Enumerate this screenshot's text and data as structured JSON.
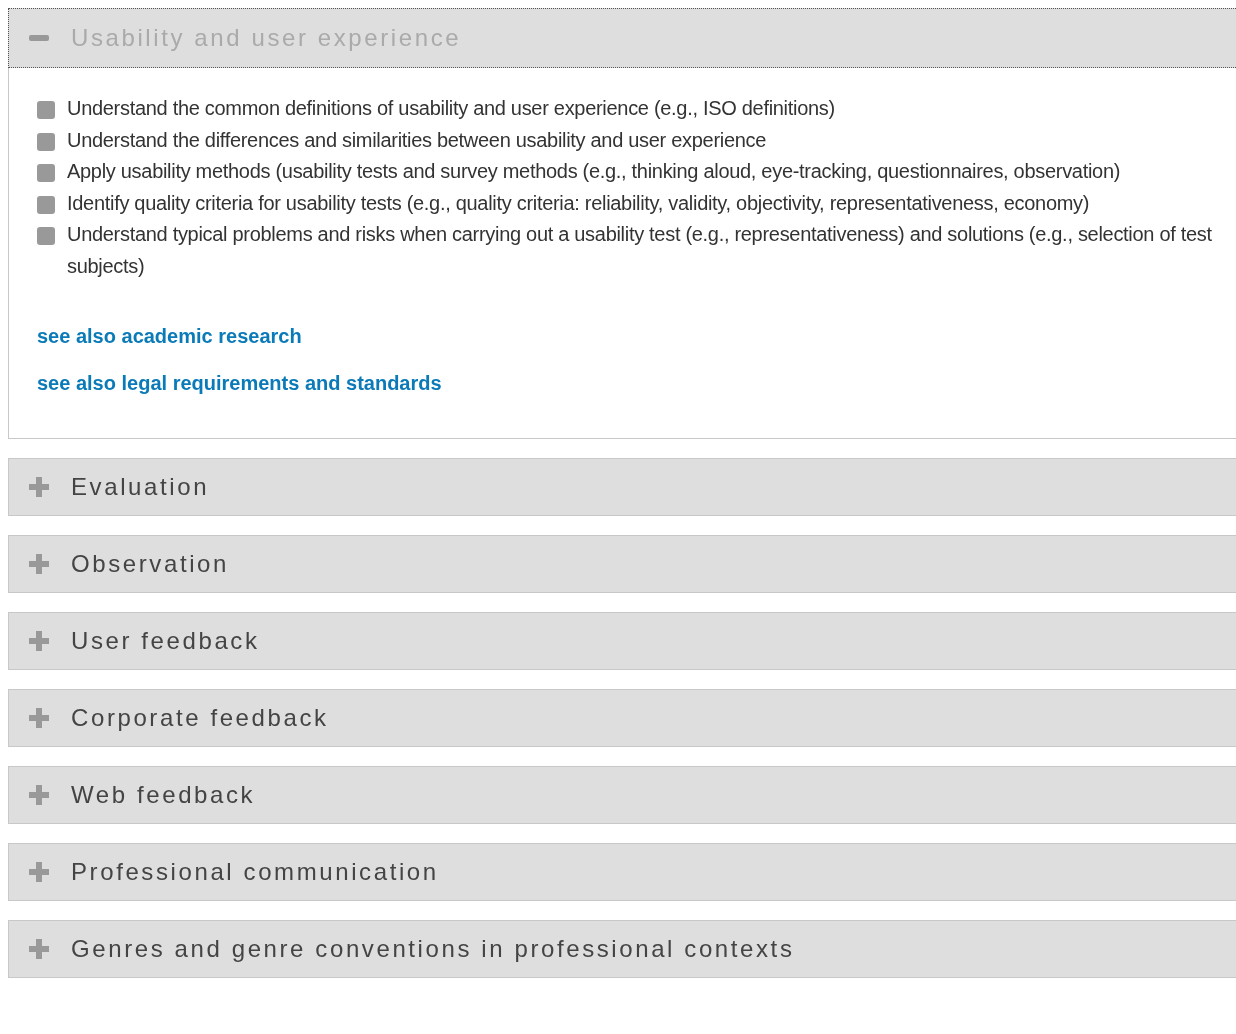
{
  "sections": [
    {
      "title": "Usability and user experience",
      "expanded": true,
      "items": [
        "Understand the common definitions of usability and user experience (e.g., ISO definitions)",
        "Understand the differences and similarities between usability and user experience",
        "Apply usability methods (usability tests and survey methods (e.g., thinking aloud, eye-tracking, questionnaires, observation)",
        "Identify quality criteria for usability tests (e.g., quality criteria: reliability, validity, objectivity, representativeness, economy)",
        "Understand typical problems and risks when carrying out a usability test (e.g., representativeness) and solutions (e.g., selection of test subjects)"
      ],
      "links": [
        "see also academic research",
        "see also legal requirements and standards"
      ]
    },
    {
      "title": "Evaluation",
      "expanded": false
    },
    {
      "title": "Observation",
      "expanded": false
    },
    {
      "title": "User feedback",
      "expanded": false
    },
    {
      "title": "Corporate feedback",
      "expanded": false
    },
    {
      "title": "Web feedback",
      "expanded": false
    },
    {
      "title": "Professional communication",
      "expanded": false
    },
    {
      "title": "Genres and genre conventions in professional contexts",
      "expanded": false
    }
  ]
}
